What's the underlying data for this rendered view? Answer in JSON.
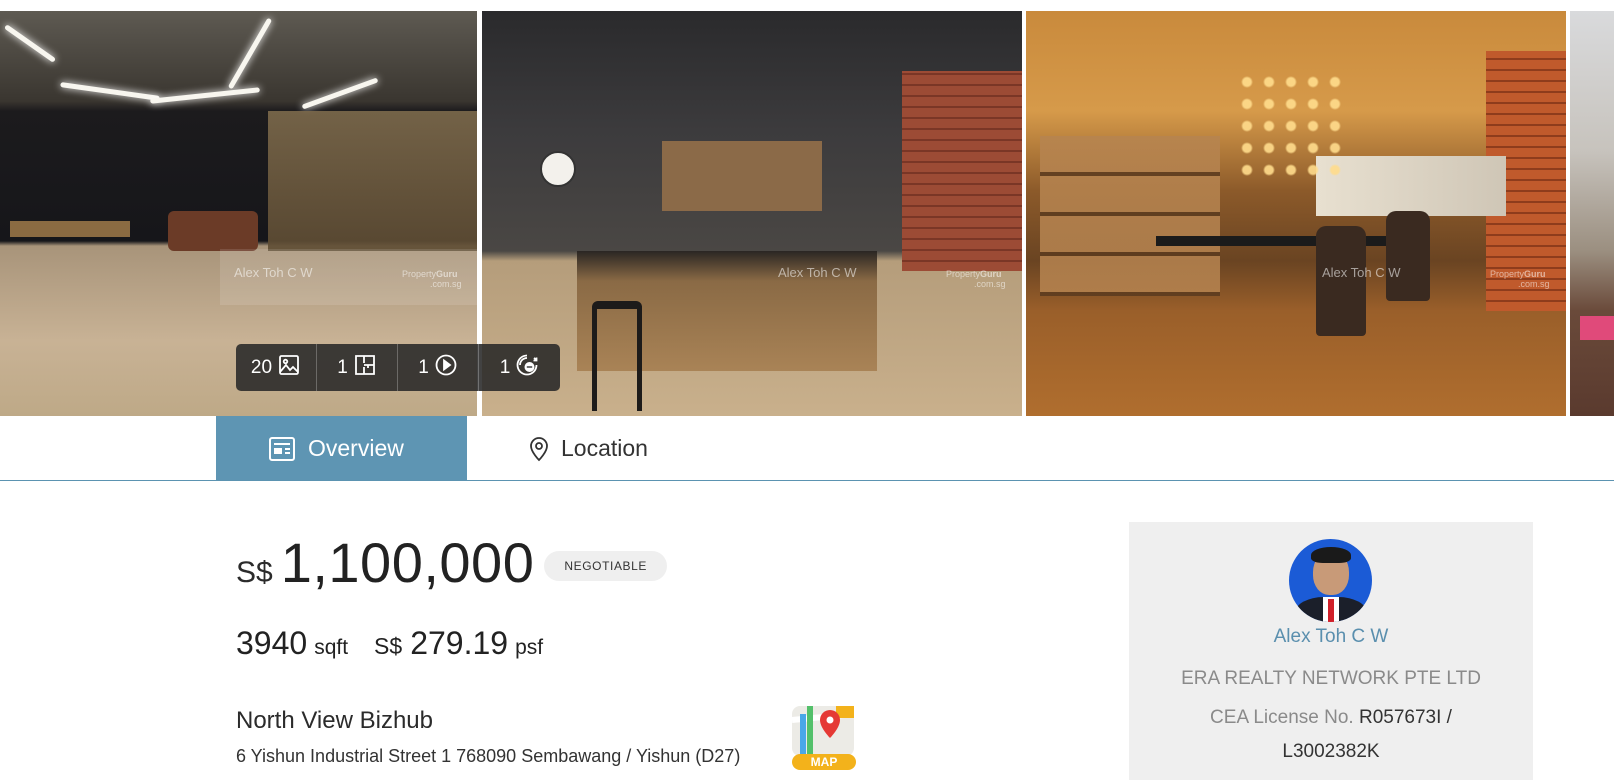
{
  "gallery": {
    "watermark_name": "Alex Toh C W",
    "watermark_logo_top": "Property",
    "watermark_logo_brand": "Guru",
    "watermark_logo_sub": ".com.sg",
    "media_counts": [
      {
        "count": "1",
        "icon": "floorplan-icon"
      },
      {
        "count": "20",
        "icon": "photos-icon"
      },
      {
        "count": "1",
        "icon": "video-play-icon"
      },
      {
        "count": "1",
        "icon": "360-view-icon"
      }
    ]
  },
  "tabs": {
    "overview_label": "Overview",
    "location_label": "Location",
    "active_color": "#5e95b3"
  },
  "listing": {
    "currency": "S$",
    "price": "1,100,000",
    "negotiable_badge": "NEGOTIABLE",
    "area_value": "3940",
    "area_unit": "sqft",
    "psf_currency": "S$",
    "psf_value": "279.19",
    "psf_unit": "psf",
    "building_name": "North View Bizhub",
    "address": "6 Yishun Industrial Street 1 768090 Sembawang / Yishun (D27)",
    "map_label": "MAP"
  },
  "agent": {
    "name": "Alex Toh C W",
    "company": "ERA REALTY NETWORK PTE LTD",
    "license_label": "CEA License No.",
    "license_number": "R057673I / L3002382K",
    "name_color": "#5a8fae"
  }
}
